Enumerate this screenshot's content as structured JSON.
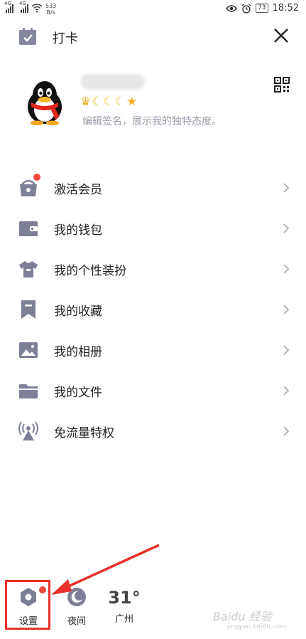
{
  "status_bar": {
    "net1": "4G",
    "net2": "4G",
    "speed_value": "533",
    "speed_unit": "B/s",
    "battery": "73",
    "time": "18:52"
  },
  "header": {
    "title": "打卡"
  },
  "profile": {
    "signature": "编辑签名，展示我的独特态度。"
  },
  "menu": [
    {
      "label": "激活会员",
      "icon": "shop-bag-icon",
      "badge": true
    },
    {
      "label": "我的钱包",
      "icon": "wallet-icon",
      "badge": false
    },
    {
      "label": "我的个性装扮",
      "icon": "tshirt-icon",
      "badge": false
    },
    {
      "label": "我的收藏",
      "icon": "bookmark-icon",
      "badge": false
    },
    {
      "label": "我的相册",
      "icon": "photo-icon",
      "badge": false
    },
    {
      "label": "我的文件",
      "icon": "folder-icon",
      "badge": false
    },
    {
      "label": "免流量特权",
      "icon": "antenna-icon",
      "badge": false
    }
  ],
  "bottom": {
    "settings_label": "设置",
    "night_label": "夜间",
    "temperature": "31°",
    "city": "广州"
  },
  "watermark": {
    "text": "Baidu 经验",
    "sub": "jingyan.baidu.com"
  },
  "colors": {
    "icon_gray": "#7d7f97",
    "badge_red": "#f0483c",
    "highlight_red": "#e8302a"
  }
}
